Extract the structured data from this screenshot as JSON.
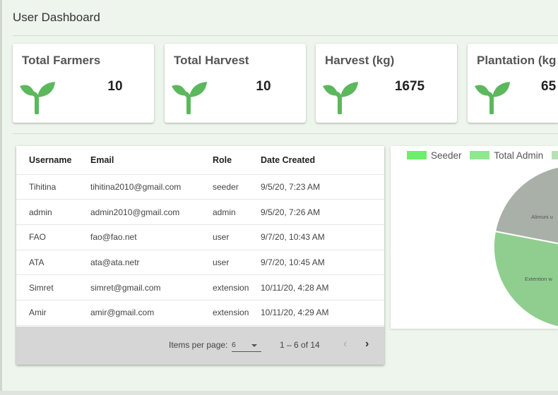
{
  "page": {
    "title": "User Dashboard"
  },
  "stats": [
    {
      "title": "Total Farmers",
      "value": "10",
      "icon": "sprout-icon"
    },
    {
      "title": "Total Harvest",
      "value": "10",
      "icon": "sprout-icon"
    },
    {
      "title": "Harvest (kg)",
      "value": "1675",
      "icon": "sprout-icon"
    },
    {
      "title": "Plantation (kg",
      "value": "65",
      "icon": "sprout-icon"
    }
  ],
  "table": {
    "headers": [
      "Username",
      "Email",
      "Role",
      "Date Created"
    ],
    "rows": [
      [
        "Tihitina",
        "tihitina2010@gmail.com",
        "seeder",
        "9/5/20, 7:23 AM"
      ],
      [
        "admin",
        "admin2010@gmail.com",
        "admin",
        "9/5/20, 7:26 AM"
      ],
      [
        "FAO",
        "fao@fao.net",
        "user",
        "9/7/20, 10:43 AM"
      ],
      [
        "ATA",
        "ata@ata.netr",
        "user",
        "9/7/20, 10:45 AM"
      ],
      [
        "Simret",
        "simret@gmail.com",
        "extension",
        "10/11/20, 4:28 AM"
      ],
      [
        "Amir",
        "amir@gmail.com",
        "extension",
        "10/11/20, 4:29 AM"
      ]
    ]
  },
  "paginator": {
    "items_per_page_label": "Items per page:",
    "page_size": "6",
    "range_label": "1 – 6 of 14",
    "prev_icon": "chevron-left-icon",
    "next_icon": "chevron-right-icon"
  },
  "chart_data": {
    "type": "pie",
    "legend": [
      {
        "label": "Seeder",
        "color": "#6af06a"
      },
      {
        "label": "Total Admin",
        "color": "#8fe88f"
      }
    ],
    "slices": [
      {
        "label": "Alimuni u",
        "color": "#a9b0a8"
      },
      {
        "label": "Extention w",
        "color": "#8fce8f"
      }
    ]
  },
  "colors": {
    "accent": "#5cb85c",
    "sprout": "#5cb85c",
    "page_bg": "#edf5ec"
  }
}
